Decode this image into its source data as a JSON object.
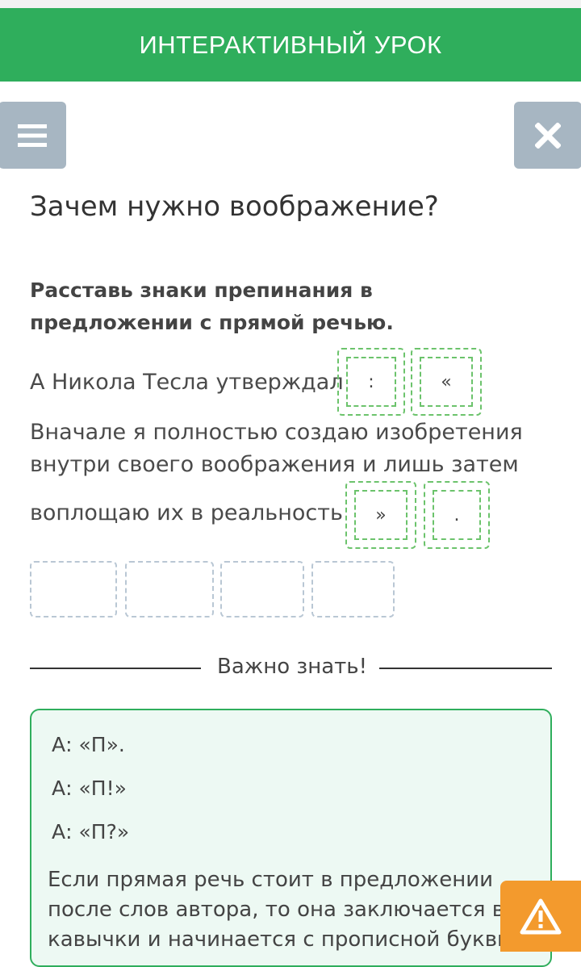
{
  "header": {
    "title": "ИНТЕРАКТИВНЫЙ УРОК"
  },
  "icons": {
    "menu": "hamburger-icon",
    "close": "close-icon",
    "warning": "warning-icon"
  },
  "lesson": {
    "title": "Зачем нужно воображение?",
    "task": "Расставь знаки препинания в предложении с прямой речью.",
    "sentence": {
      "line1": "А Никола Тесла утверждал",
      "line2": "Вначале я полностью создаю изобретения",
      "line3": "внутри своего воображения и лишь затем",
      "line4": "воплощаю их в реальность"
    },
    "slots": [
      ":",
      "«",
      "»",
      "."
    ]
  },
  "divider": {
    "label": "Важно знать!"
  },
  "info": {
    "examples": [
      "А: «П».",
      "А: «П!»",
      "А: «П?»"
    ],
    "rule": "Если прямая речь стоит в предложении после слов автора, то она заключается в кавычки и начинается с прописной буквы"
  },
  "colors": {
    "accent": "#2fae5c",
    "button": "#a7b6c2",
    "warning": "#f39a2d"
  }
}
